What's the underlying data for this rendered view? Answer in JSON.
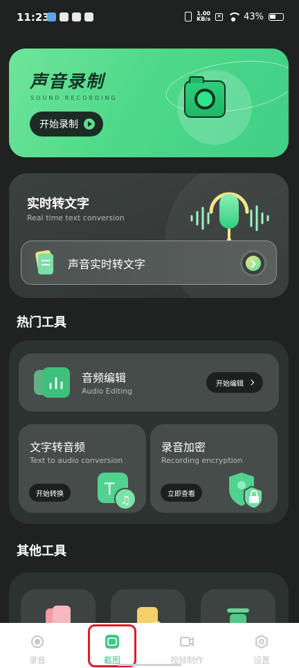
{
  "status_bar": {
    "time": "11:23",
    "net_speed_value": "1.00",
    "net_speed_unit": "KB/s",
    "battery": "43%"
  },
  "hero": {
    "title": "声音录制",
    "subtitle": "SOUND RECORDING",
    "button_label": "开始录制"
  },
  "realtime": {
    "title": "实时转文字",
    "subtitle": "Real time text conversion",
    "action_label": "声音实时转文字"
  },
  "hot_tools": {
    "section_title": "热门工具",
    "audio_edit": {
      "title": "音频编辑",
      "subtitle": "Audio Editing",
      "button_label": "开始编辑"
    },
    "text_to_audio": {
      "title": "文字转音频",
      "subtitle": "Text to audio conversion",
      "button_label": "开始转换"
    },
    "recording_encryption": {
      "title": "录音加密",
      "subtitle": "Recording encryption",
      "button_label": "立即查看"
    }
  },
  "other_tools": {
    "section_title": "其他工具"
  },
  "nav": {
    "items": [
      {
        "label": "录音",
        "icon": "record-icon",
        "active": false
      },
      {
        "label": "截图",
        "icon": "screenshot-icon",
        "active": true
      },
      {
        "label": "视频制作",
        "icon": "video-icon",
        "active": false
      },
      {
        "label": "设置",
        "icon": "settings-icon",
        "active": false
      }
    ]
  },
  "colors": {
    "accent": "#3fc98a",
    "hero_gradient_start": "#6fe59a",
    "background": "#1f2221",
    "highlight_box": "#e3172b"
  }
}
